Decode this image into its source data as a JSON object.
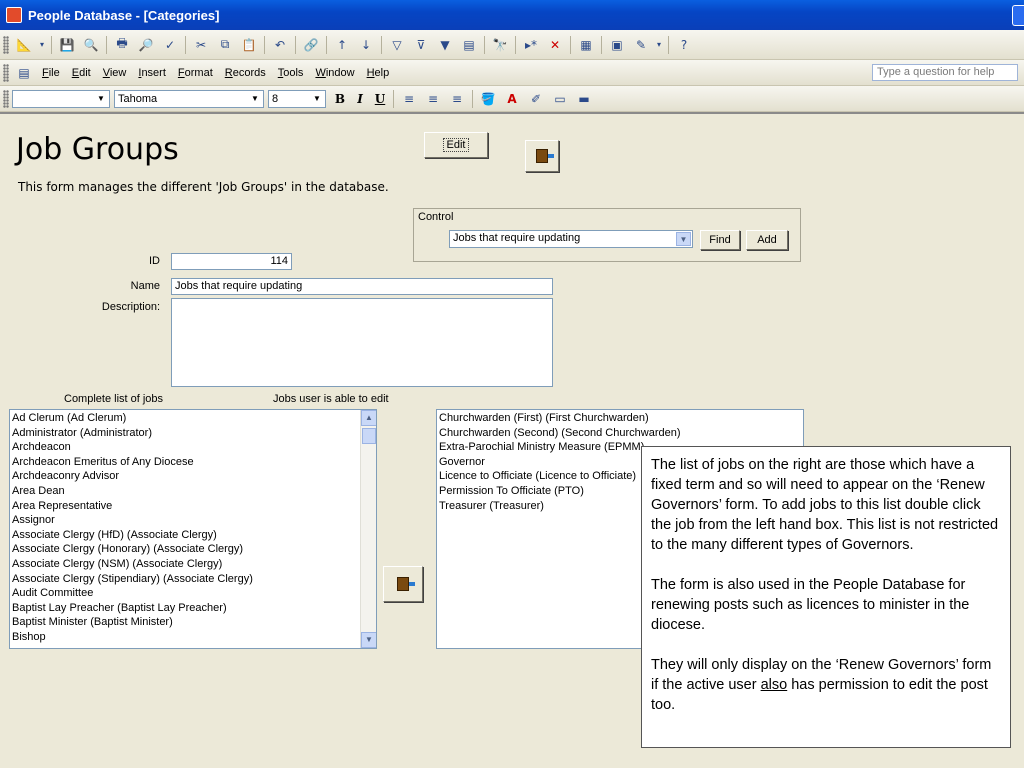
{
  "window": {
    "title": "People Database - [Categories]"
  },
  "menu": {
    "items": [
      "File",
      "Edit",
      "View",
      "Insert",
      "Format",
      "Records",
      "Tools",
      "Window",
      "Help"
    ],
    "help_placeholder": "Type a question for help"
  },
  "format_bar": {
    "object": "",
    "font": "Tahoma",
    "size": "8",
    "bold": "B",
    "italic": "I",
    "underline": "U"
  },
  "form": {
    "title": "Job Groups",
    "subtitle": "This form manages the different 'Job Groups' in the database.",
    "edit_label": "Edit",
    "control": {
      "label": "Control",
      "selected": "Jobs that require updating",
      "find_label": "Find",
      "add_label": "Add"
    },
    "id_label": "ID",
    "id_value": "114",
    "name_label": "Name",
    "name_value": "Jobs that require updating",
    "description_label": "Description:",
    "description_value": "",
    "left_list_label": "Complete list of jobs",
    "right_list_label": "Jobs user is able to edit",
    "left_list": [
      "Ad Clerum (Ad Clerum)",
      "Administrator (Administrator)",
      "Archdeacon",
      "Archdeacon Emeritus of Any Diocese",
      "Archdeaconry Advisor",
      "Area Dean",
      "Area Representative",
      "Assignor",
      "Associate Clergy (HfD) (Associate Clergy)",
      "Associate Clergy (Honorary) (Associate Clergy)",
      "Associate Clergy (NSM) (Associate Clergy)",
      "Associate Clergy (Stipendiary) (Associate Clergy)",
      "Audit Committee",
      "Baptist Lay Preacher (Baptist Lay Preacher)",
      "Baptist Minister (Baptist Minister)",
      "Bishop"
    ],
    "right_list": [
      "Churchwarden (First) (First Churchwarden)",
      "Churchwarden (Second) (Second Churchwarden)",
      "Extra-Parochial Ministry Measure (EPMM)",
      "Governor",
      "Licence to Officiate (Licence to Officiate)",
      "Permission To Officiate (PTO)",
      "Treasurer (Treasurer)"
    ]
  },
  "callout": {
    "p1": "The list of jobs on the right are those which have a fixed term and so will need to appear on the ‘Renew Governors’ form.  To add jobs to this list double click the job from the left hand box. This list is not restricted to the many different types of Governors.",
    "p2": "The form is also used in the People Database for renewing posts such as licences to minister in the diocese.",
    "p3_before": "They will only display on the ‘Renew Governors’ form if the active user ",
    "p3_emph": "also",
    "p3_after": " has permission to edit the post too."
  }
}
